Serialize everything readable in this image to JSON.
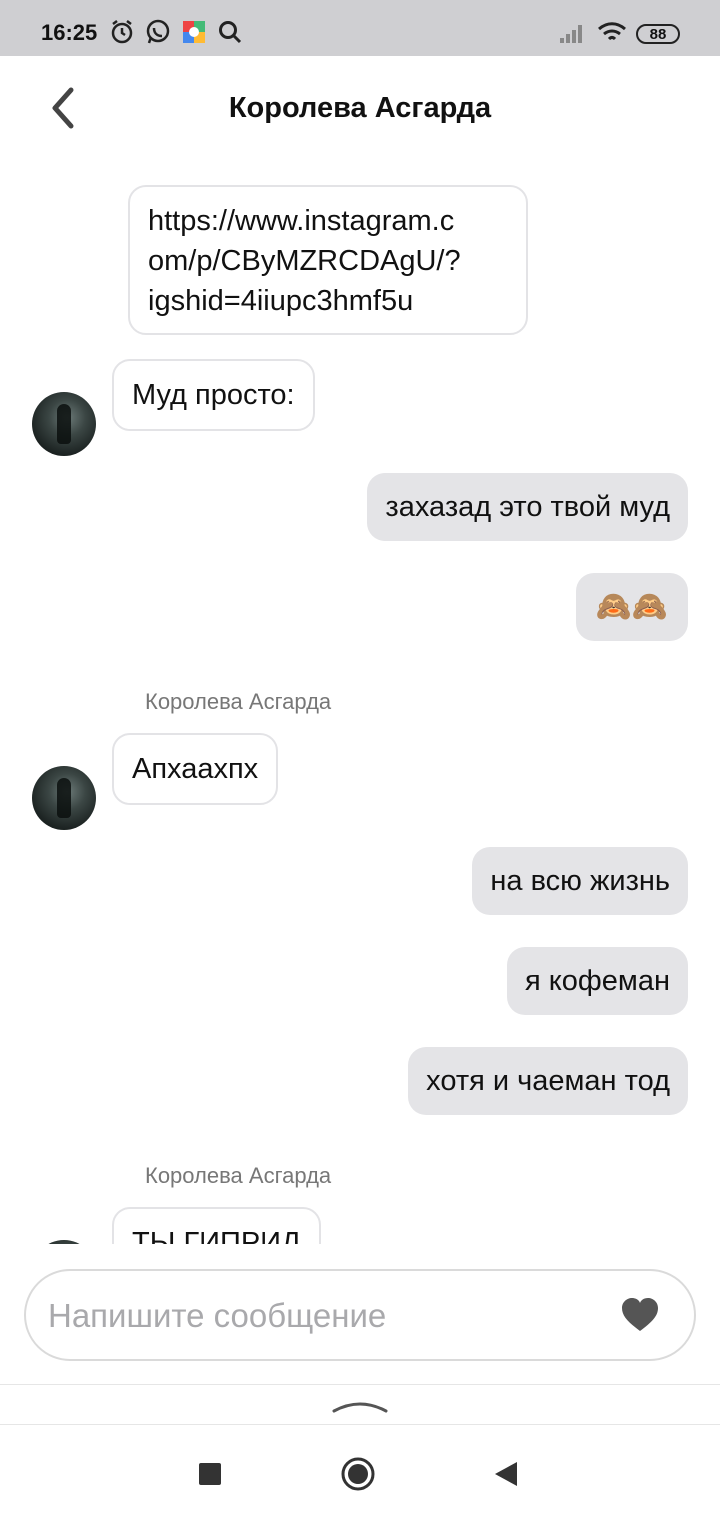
{
  "status_bar": {
    "time": "16:25",
    "battery": "88",
    "icons": [
      "alarm-icon",
      "whatsapp-icon",
      "app-icon",
      "search-icon",
      "signal-icon",
      "wifi-icon",
      "battery-icon"
    ]
  },
  "header": {
    "back_icon": "chevron-left-icon",
    "title": "Королева Асгарда"
  },
  "messages": [
    {
      "direction": "in",
      "text_lines": [
        "https://www.instagram.c",
        "om/p/CByMZRCDAgU/?",
        "igshid=4iiupc3hmf5u"
      ]
    },
    {
      "direction": "in",
      "text": "Муд просто:",
      "avatar": true
    },
    {
      "direction": "out",
      "text": "захазад это твой муд"
    },
    {
      "direction": "out",
      "text": "🙈🙈"
    },
    {
      "sender": "Королева Асгарда"
    },
    {
      "direction": "in",
      "text": "Апхаахпх",
      "avatar": true
    },
    {
      "direction": "out",
      "text": "на всю жизнь"
    },
    {
      "direction": "out",
      "text": "я кофеман"
    },
    {
      "direction": "out",
      "text": "хотя и чаеман тод"
    },
    {
      "sender": "Королева Асгарда"
    },
    {
      "direction": "in",
      "text": "ТЫ ГИПРИД",
      "avatar": true
    }
  ],
  "composer": {
    "placeholder": "Напишите сообщение",
    "heart_icon": "heart-icon"
  },
  "nav": {
    "items": [
      "recent-apps-icon",
      "home-icon",
      "back-icon"
    ]
  },
  "colors": {
    "status_bar_bg": "#cfcfd2",
    "outgoing_bubble": "#e4e4e7",
    "incoming_border": "#e3e3e6"
  }
}
